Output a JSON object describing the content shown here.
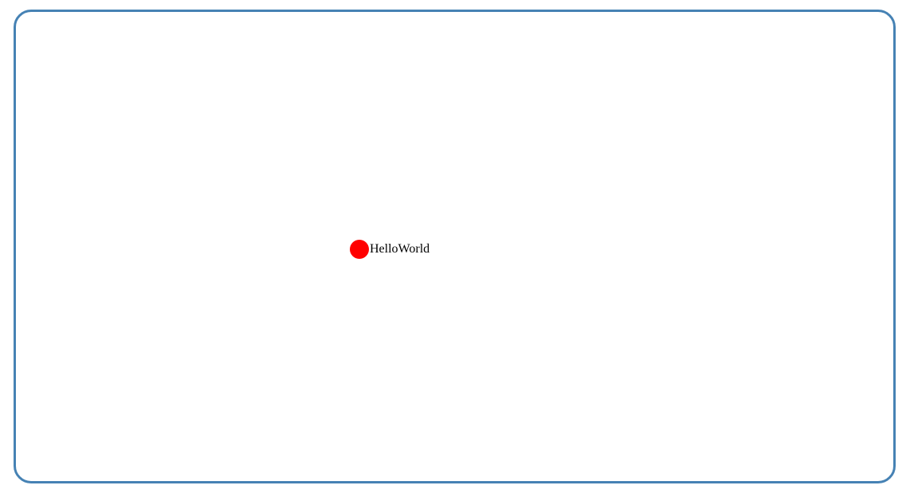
{
  "canvas": {
    "border_color": "#4682b4",
    "background": "#ffffff"
  },
  "marker": {
    "label": "HelloWorld",
    "dot_color": "#ff0000"
  }
}
